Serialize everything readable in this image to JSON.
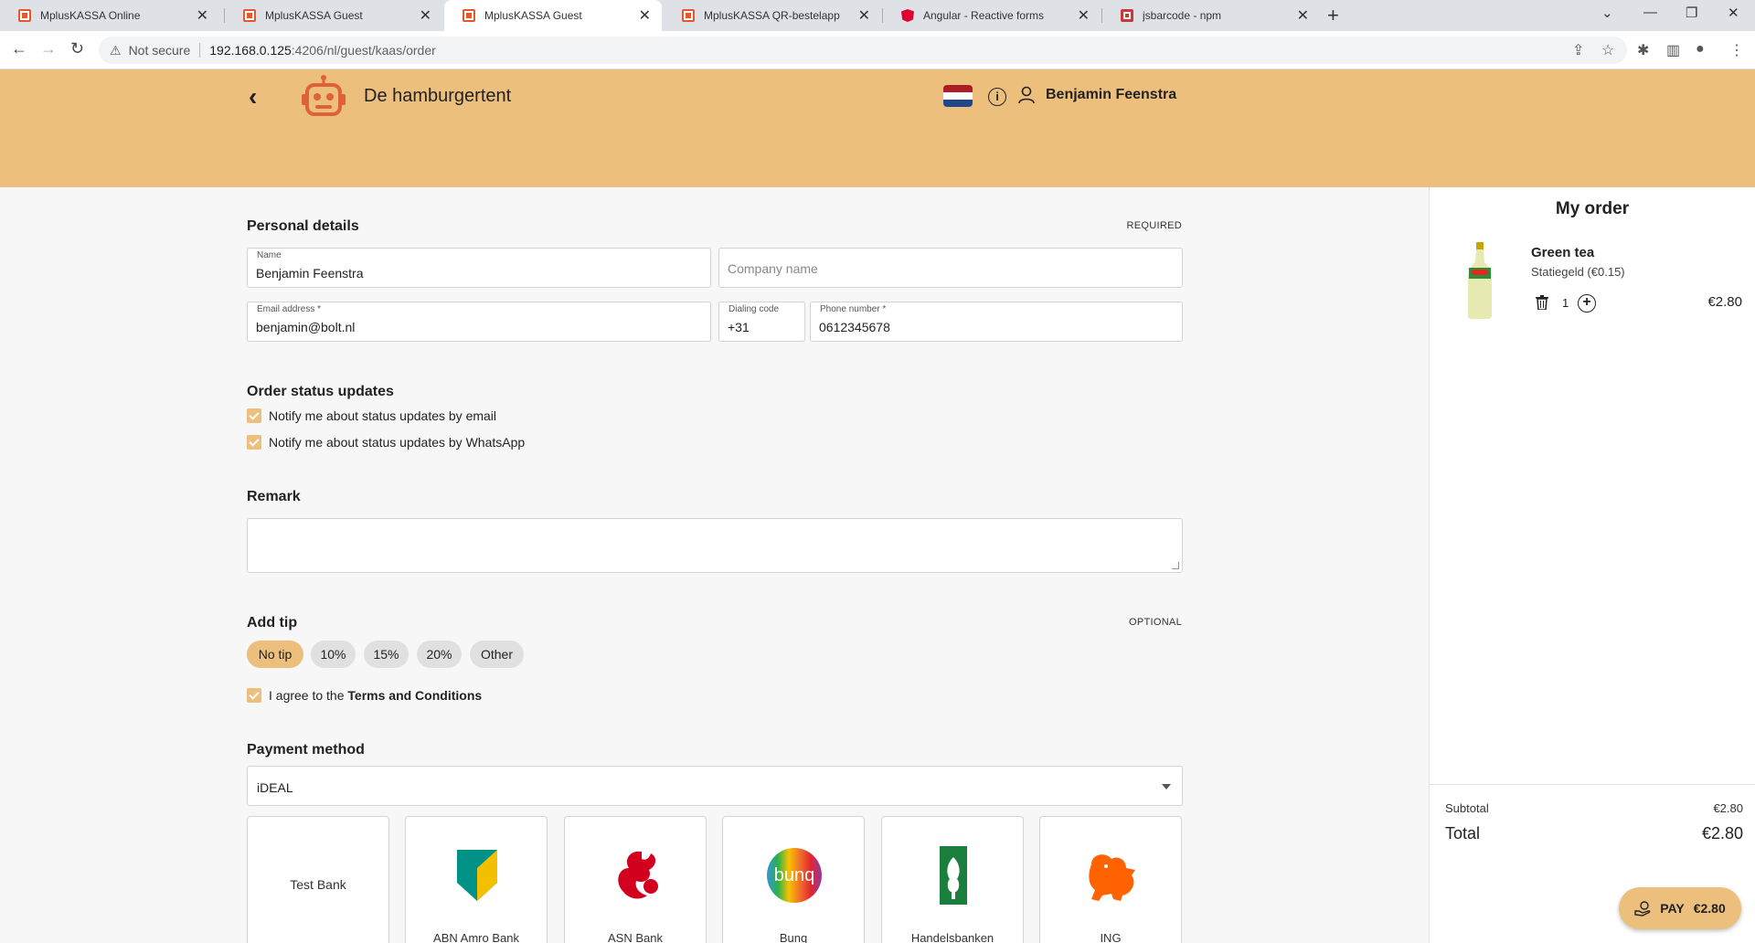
{
  "browser": {
    "tabs": [
      {
        "title": "MplusKASSA Online",
        "favicon": "mpluskassa-icon",
        "active": false
      },
      {
        "title": "MplusKASSA Guest",
        "favicon": "mpluskassa-icon",
        "active": false
      },
      {
        "title": "MplusKASSA Guest",
        "favicon": "mpluskassa-icon",
        "active": true
      },
      {
        "title": "MplusKASSA QR-bestelapp",
        "favicon": "mpluskassa-icon",
        "active": false
      },
      {
        "title": "Angular - Reactive forms",
        "favicon": "angular-icon",
        "active": false
      },
      {
        "title": "jsbarcode - npm",
        "favicon": "npm-icon",
        "active": false
      }
    ],
    "security_label": "Not secure",
    "url_host": "192.168.0.125",
    "url_path": ":4206/nl/guest/kaas/order"
  },
  "header": {
    "shop_name": "De hamburgertent",
    "user_name": "Benjamin Feenstra",
    "background_color": "#ecbf7c"
  },
  "personal": {
    "title": "Personal details",
    "required_tag": "REQUIRED",
    "name_label": "Name",
    "name_value": "Benjamin Feenstra",
    "company_placeholder": "Company name",
    "email_label": "Email address *",
    "email_value": "benjamin@bolt.nl",
    "dialing_label": "Dialing code",
    "dialing_value": "+31",
    "phone_label": "Phone number *",
    "phone_value": "0612345678"
  },
  "status_updates": {
    "title": "Order status updates",
    "email_option": "Notify me about status updates by email",
    "whatsapp_option": "Notify me about status updates by WhatsApp"
  },
  "remark": {
    "title": "Remark"
  },
  "tip": {
    "title": "Add tip",
    "optional_tag": "OPTIONAL",
    "options": [
      "No tip",
      "10%",
      "15%",
      "20%",
      "Other"
    ],
    "selected": "No tip"
  },
  "terms": {
    "prefix": "I agree to the ",
    "link": "Terms and Conditions"
  },
  "payment": {
    "title": "Payment method",
    "selected_method": "iDEAL",
    "banks": [
      {
        "name": "Test Bank",
        "logo": null
      },
      {
        "name": "ABN Amro Bank",
        "logo": "abn-amro-logo"
      },
      {
        "name": "ASN Bank",
        "logo": "asn-bank-logo"
      },
      {
        "name": "Bunq",
        "logo": "bunq-logo"
      },
      {
        "name": "Handelsbanken",
        "logo": "handelsbanken-logo"
      },
      {
        "name": "ING",
        "logo": "ing-logo"
      }
    ]
  },
  "order": {
    "title": "My order",
    "items": [
      {
        "name": "Green tea",
        "deposit": "Statiegeld (€0.15)",
        "quantity": "1",
        "price": "€2.80"
      }
    ],
    "subtotal_label": "Subtotal",
    "subtotal_value": "€2.80",
    "total_label": "Total",
    "total_value": "€2.80",
    "pay_label": "PAY",
    "pay_amount": "€2.80"
  }
}
